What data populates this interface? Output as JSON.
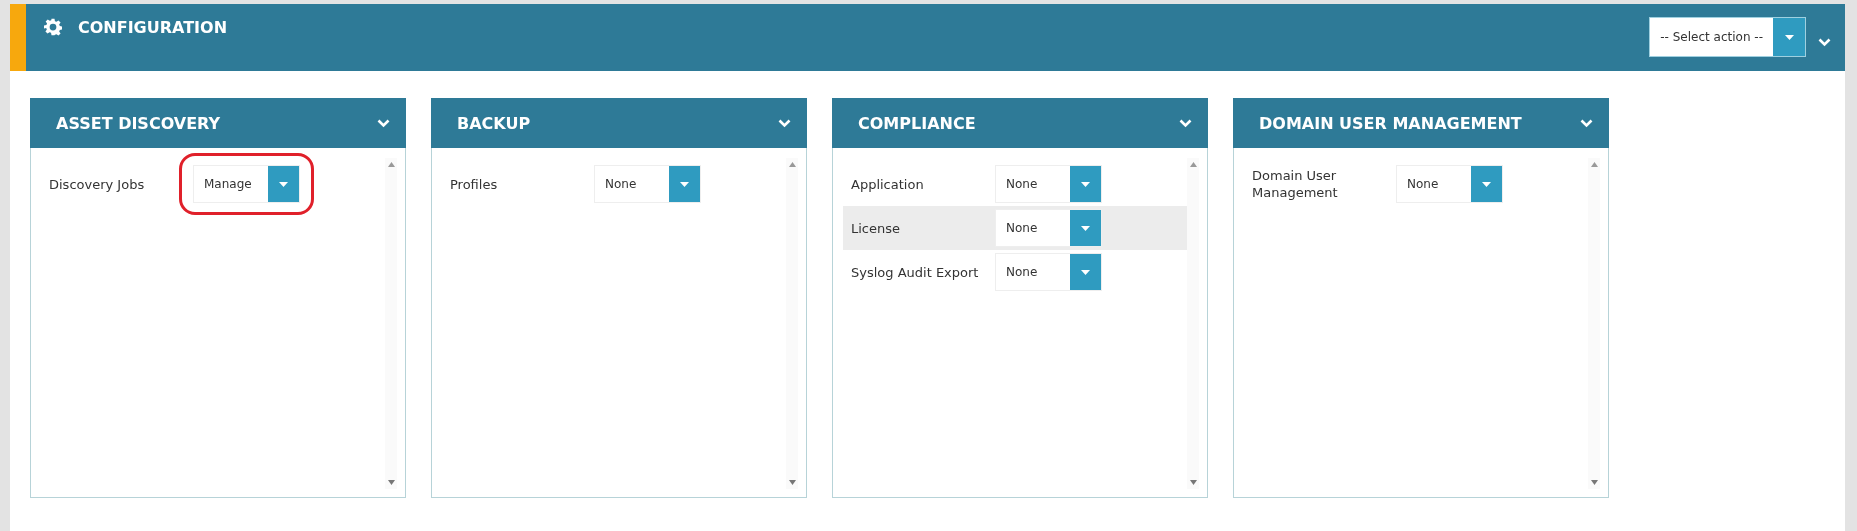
{
  "header": {
    "title": "CONFIGURATION",
    "action_select": {
      "value": "-- Select action --"
    }
  },
  "panels": [
    {
      "title": "ASSET DISCOVERY",
      "rows": [
        {
          "label": "Discovery Jobs",
          "value": "Manage",
          "highlighted": false,
          "circled": true
        }
      ]
    },
    {
      "title": "BACKUP",
      "rows": [
        {
          "label": "Profiles",
          "value": "None",
          "highlighted": false,
          "circled": false
        }
      ]
    },
    {
      "title": "COMPLIANCE",
      "rows": [
        {
          "label": "Application",
          "value": "None",
          "highlighted": false,
          "circled": false
        },
        {
          "label": "License",
          "value": "None",
          "highlighted": true,
          "circled": false
        },
        {
          "label": "Syslog Audit Export",
          "value": "None",
          "highlighted": false,
          "circled": false
        }
      ]
    },
    {
      "title": "DOMAIN USER MANAGEMENT",
      "rows": [
        {
          "label": "Domain User Management",
          "value": "None",
          "highlighted": false,
          "circled": false
        }
      ]
    }
  ]
}
